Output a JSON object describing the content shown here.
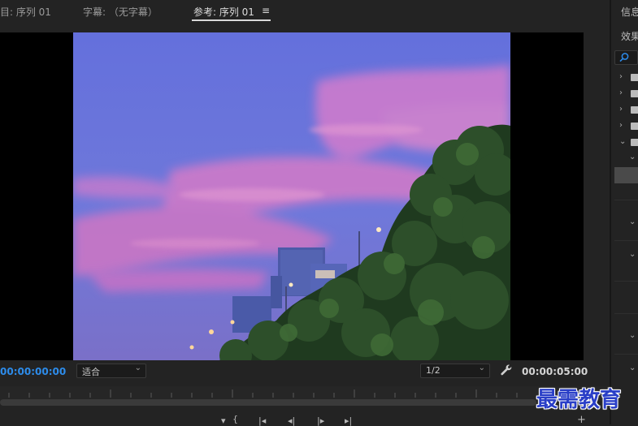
{
  "tabs": [
    {
      "label": "目: 序列 01",
      "active": false
    },
    {
      "label": "字幕: （无字幕）",
      "active": false
    },
    {
      "label": "参考: 序列 01",
      "active": true
    }
  ],
  "tab_menu_icon": "hamburger-icon",
  "viewer": {
    "timecode_current": "00:00:00:00",
    "fit_select": "适合",
    "resolution_select": "1/2",
    "timecode_duration": "00:00:05:00"
  },
  "right_panel": {
    "tab_info": "信息",
    "tab_effects": "效果"
  },
  "watermark": "最需教育",
  "colors": {
    "accent_blue": "#2d8ceb",
    "background": "#232323",
    "sky": "#6a74dc",
    "cloud": "#d47ac8"
  }
}
